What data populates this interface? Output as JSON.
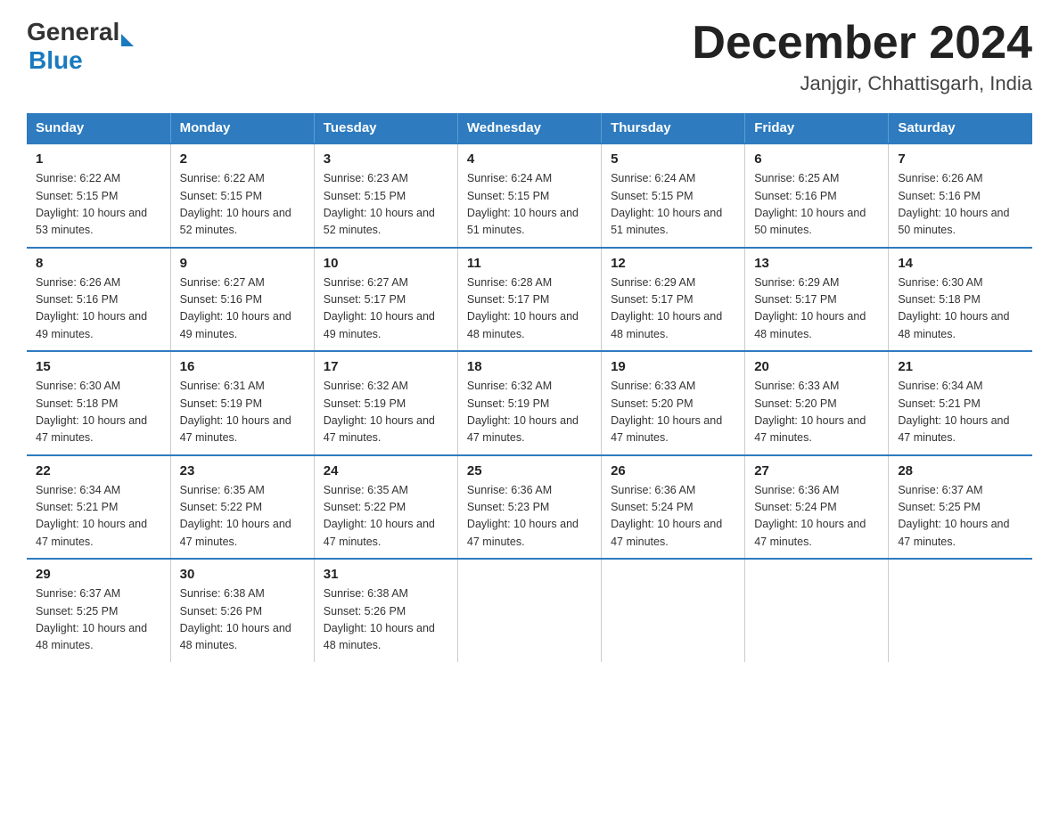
{
  "logo": {
    "general": "General",
    "blue": "Blue"
  },
  "title": "December 2024",
  "location": "Janjgir, Chhattisgarh, India",
  "weekdays": [
    "Sunday",
    "Monday",
    "Tuesday",
    "Wednesday",
    "Thursday",
    "Friday",
    "Saturday"
  ],
  "weeks": [
    [
      {
        "day": "1",
        "sunrise": "6:22 AM",
        "sunset": "5:15 PM",
        "daylight": "10 hours and 53 minutes."
      },
      {
        "day": "2",
        "sunrise": "6:22 AM",
        "sunset": "5:15 PM",
        "daylight": "10 hours and 52 minutes."
      },
      {
        "day": "3",
        "sunrise": "6:23 AM",
        "sunset": "5:15 PM",
        "daylight": "10 hours and 52 minutes."
      },
      {
        "day": "4",
        "sunrise": "6:24 AM",
        "sunset": "5:15 PM",
        "daylight": "10 hours and 51 minutes."
      },
      {
        "day": "5",
        "sunrise": "6:24 AM",
        "sunset": "5:15 PM",
        "daylight": "10 hours and 51 minutes."
      },
      {
        "day": "6",
        "sunrise": "6:25 AM",
        "sunset": "5:16 PM",
        "daylight": "10 hours and 50 minutes."
      },
      {
        "day": "7",
        "sunrise": "6:26 AM",
        "sunset": "5:16 PM",
        "daylight": "10 hours and 50 minutes."
      }
    ],
    [
      {
        "day": "8",
        "sunrise": "6:26 AM",
        "sunset": "5:16 PM",
        "daylight": "10 hours and 49 minutes."
      },
      {
        "day": "9",
        "sunrise": "6:27 AM",
        "sunset": "5:16 PM",
        "daylight": "10 hours and 49 minutes."
      },
      {
        "day": "10",
        "sunrise": "6:27 AM",
        "sunset": "5:17 PM",
        "daylight": "10 hours and 49 minutes."
      },
      {
        "day": "11",
        "sunrise": "6:28 AM",
        "sunset": "5:17 PM",
        "daylight": "10 hours and 48 minutes."
      },
      {
        "day": "12",
        "sunrise": "6:29 AM",
        "sunset": "5:17 PM",
        "daylight": "10 hours and 48 minutes."
      },
      {
        "day": "13",
        "sunrise": "6:29 AM",
        "sunset": "5:17 PM",
        "daylight": "10 hours and 48 minutes."
      },
      {
        "day": "14",
        "sunrise": "6:30 AM",
        "sunset": "5:18 PM",
        "daylight": "10 hours and 48 minutes."
      }
    ],
    [
      {
        "day": "15",
        "sunrise": "6:30 AM",
        "sunset": "5:18 PM",
        "daylight": "10 hours and 47 minutes."
      },
      {
        "day": "16",
        "sunrise": "6:31 AM",
        "sunset": "5:19 PM",
        "daylight": "10 hours and 47 minutes."
      },
      {
        "day": "17",
        "sunrise": "6:32 AM",
        "sunset": "5:19 PM",
        "daylight": "10 hours and 47 minutes."
      },
      {
        "day": "18",
        "sunrise": "6:32 AM",
        "sunset": "5:19 PM",
        "daylight": "10 hours and 47 minutes."
      },
      {
        "day": "19",
        "sunrise": "6:33 AM",
        "sunset": "5:20 PM",
        "daylight": "10 hours and 47 minutes."
      },
      {
        "day": "20",
        "sunrise": "6:33 AM",
        "sunset": "5:20 PM",
        "daylight": "10 hours and 47 minutes."
      },
      {
        "day": "21",
        "sunrise": "6:34 AM",
        "sunset": "5:21 PM",
        "daylight": "10 hours and 47 minutes."
      }
    ],
    [
      {
        "day": "22",
        "sunrise": "6:34 AM",
        "sunset": "5:21 PM",
        "daylight": "10 hours and 47 minutes."
      },
      {
        "day": "23",
        "sunrise": "6:35 AM",
        "sunset": "5:22 PM",
        "daylight": "10 hours and 47 minutes."
      },
      {
        "day": "24",
        "sunrise": "6:35 AM",
        "sunset": "5:22 PM",
        "daylight": "10 hours and 47 minutes."
      },
      {
        "day": "25",
        "sunrise": "6:36 AM",
        "sunset": "5:23 PM",
        "daylight": "10 hours and 47 minutes."
      },
      {
        "day": "26",
        "sunrise": "6:36 AM",
        "sunset": "5:24 PM",
        "daylight": "10 hours and 47 minutes."
      },
      {
        "day": "27",
        "sunrise": "6:36 AM",
        "sunset": "5:24 PM",
        "daylight": "10 hours and 47 minutes."
      },
      {
        "day": "28",
        "sunrise": "6:37 AM",
        "sunset": "5:25 PM",
        "daylight": "10 hours and 47 minutes."
      }
    ],
    [
      {
        "day": "29",
        "sunrise": "6:37 AM",
        "sunset": "5:25 PM",
        "daylight": "10 hours and 48 minutes."
      },
      {
        "day": "30",
        "sunrise": "6:38 AM",
        "sunset": "5:26 PM",
        "daylight": "10 hours and 48 minutes."
      },
      {
        "day": "31",
        "sunrise": "6:38 AM",
        "sunset": "5:26 PM",
        "daylight": "10 hours and 48 minutes."
      },
      null,
      null,
      null,
      null
    ]
  ]
}
